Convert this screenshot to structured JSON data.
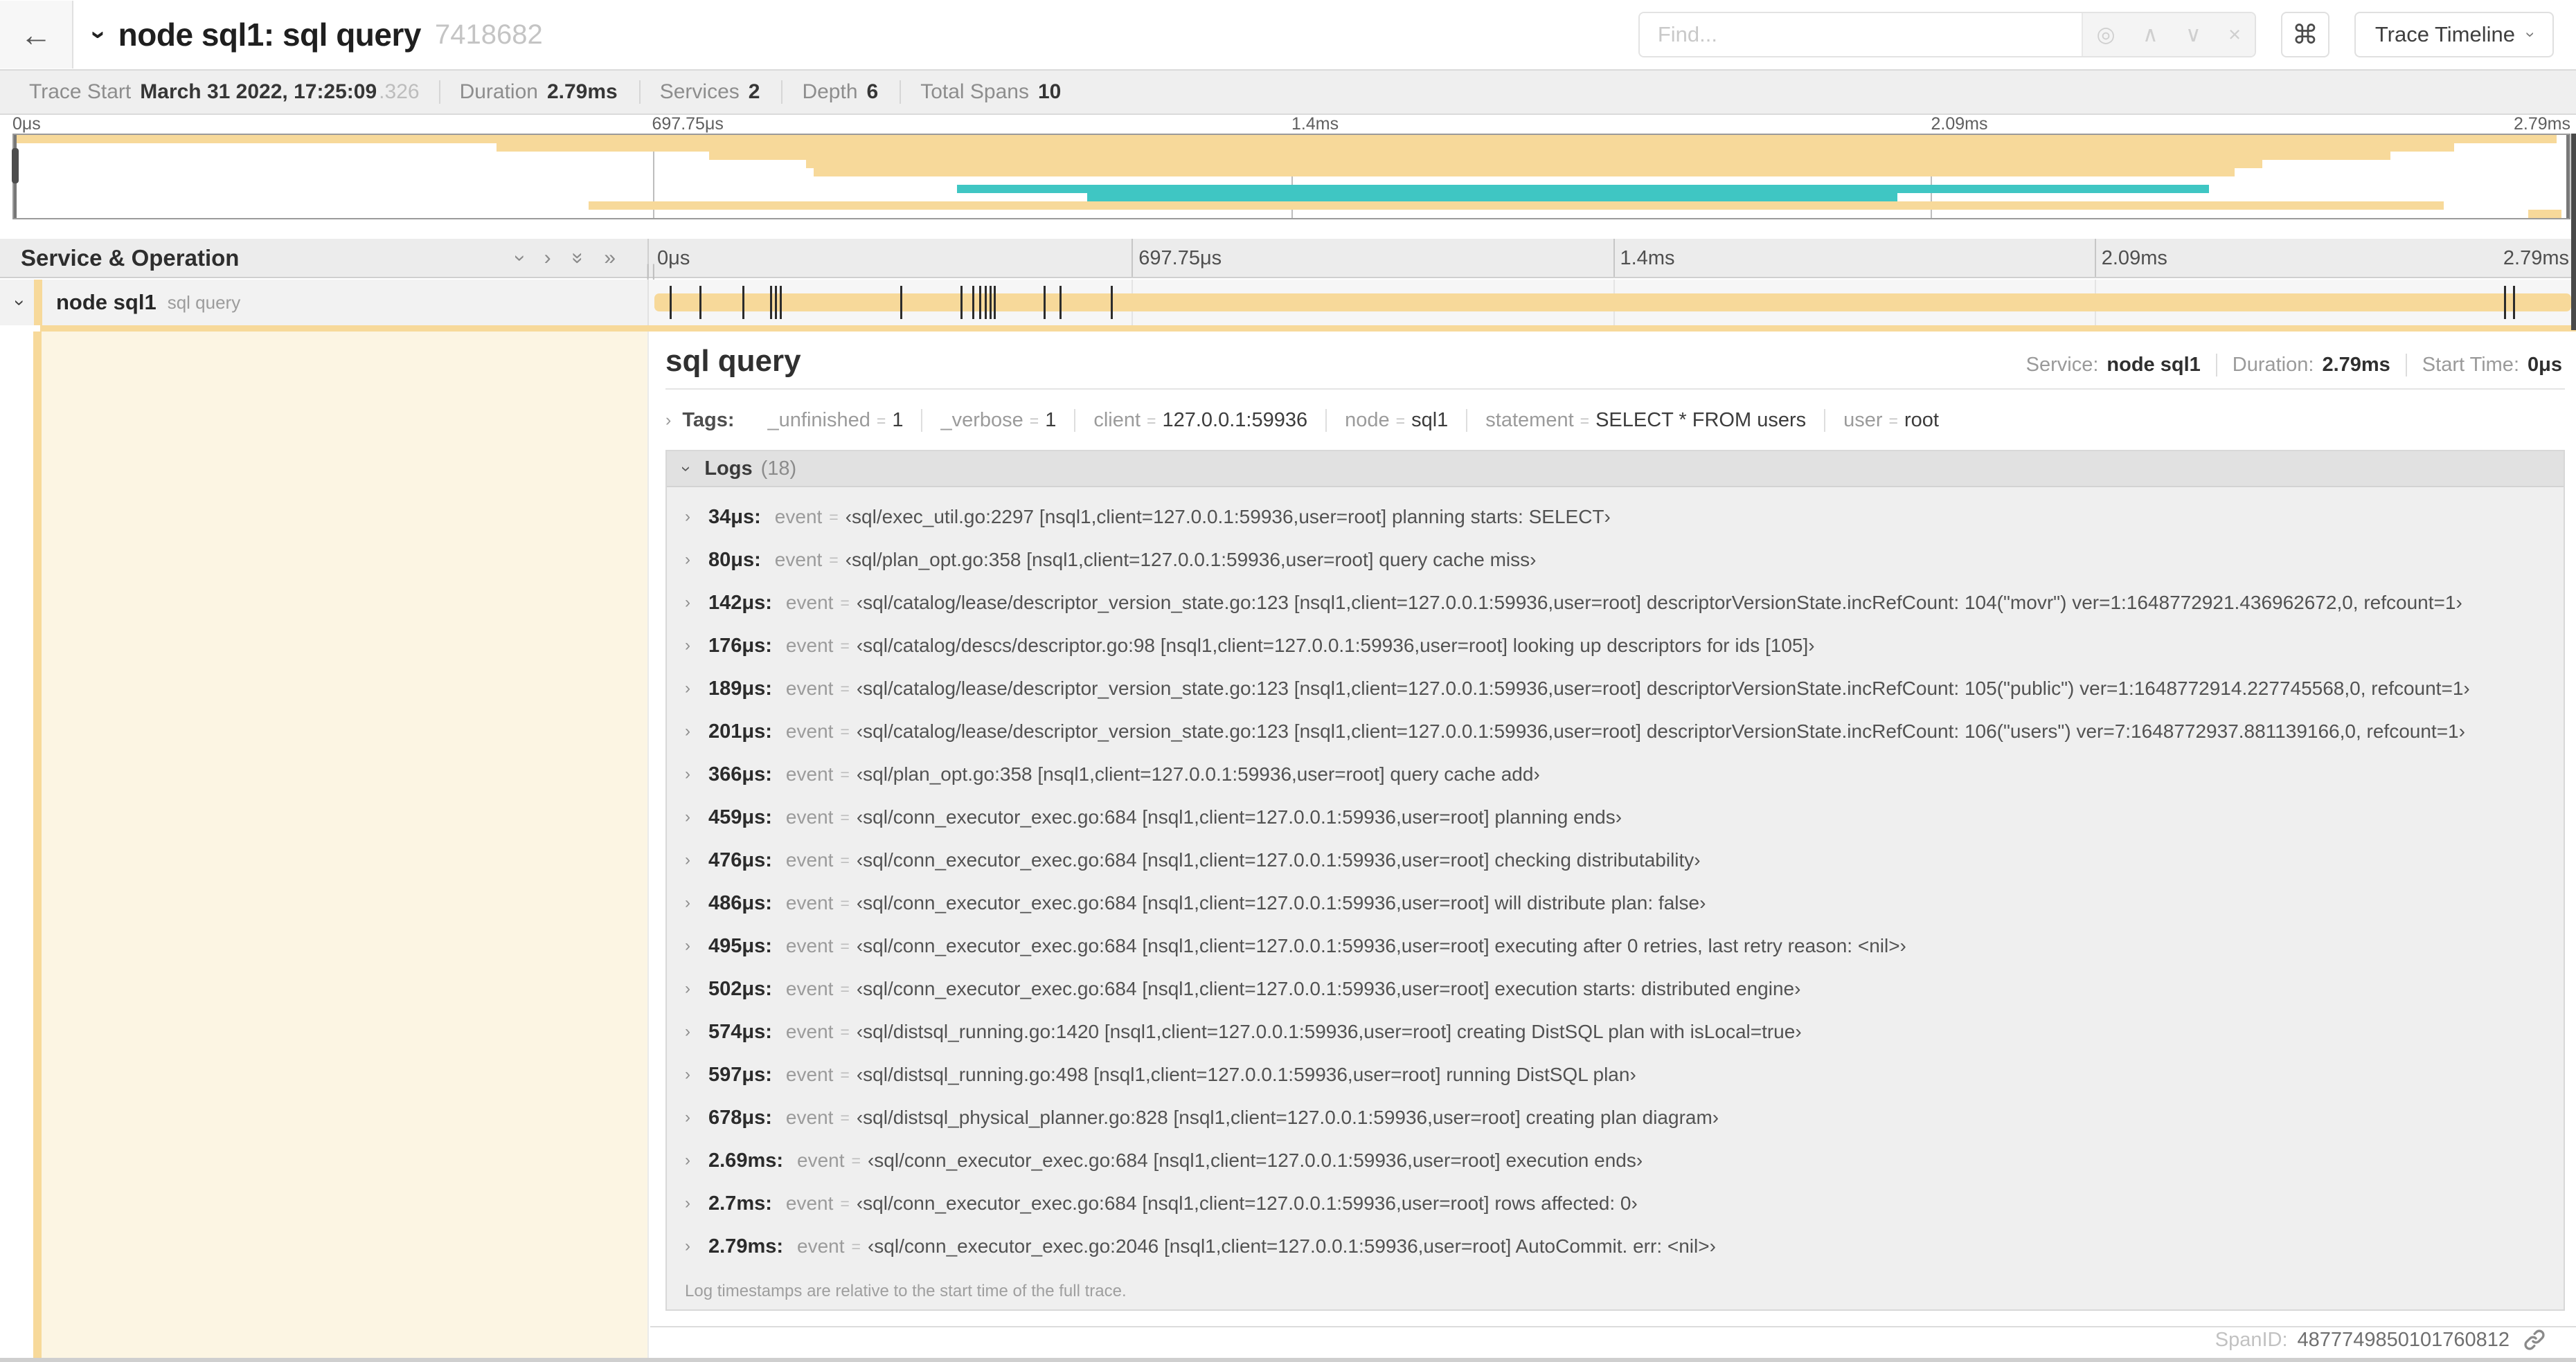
{
  "colors": {
    "span_tan": "#F7D99A",
    "span_teal": "#3FC6C3",
    "detail_cream": "#FCF5E3",
    "tick_dark": "#2C2C2C"
  },
  "header": {
    "back_glyph": "←",
    "collapse_glyph": "›",
    "title": "node sql1: sql query",
    "trace_id": "7418682",
    "find": {
      "placeholder": "Find...",
      "locate_glyph": "◎",
      "prev_glyph": "∧",
      "next_glyph": "∨",
      "clear_glyph": "×"
    },
    "shortcut_glyph": "⌘",
    "view_selector": "Trace Timeline",
    "view_chevron": "›"
  },
  "trace_meta": {
    "items": [
      {
        "label": "Trace Start",
        "value": "March 31 2022, 17:25:09",
        "suffix": ".326"
      },
      {
        "label": "Duration",
        "value": "2.79ms",
        "suffix": ""
      },
      {
        "label": "Services",
        "value": "2",
        "suffix": ""
      },
      {
        "label": "Depth",
        "value": "6",
        "suffix": ""
      },
      {
        "label": "Total Spans",
        "value": "10",
        "suffix": ""
      }
    ]
  },
  "ruler": {
    "ticks": [
      {
        "label": "0μs",
        "pct": 0,
        "tx": "translateX(0)"
      },
      {
        "label": "697.75μs",
        "pct": 25,
        "tx": "translateX(0)"
      },
      {
        "label": "1.4ms",
        "pct": 50,
        "tx": "translateX(0)"
      },
      {
        "label": "2.09ms",
        "pct": 75,
        "tx": "translateX(0)"
      },
      {
        "label": "2.79ms",
        "pct": 100,
        "tx": "translateX(-100%)"
      }
    ],
    "grid": [
      {
        "pct": 25
      },
      {
        "pct": 50
      },
      {
        "pct": 75
      }
    ]
  },
  "minimap": {
    "spans": [
      {
        "top_pct": 0,
        "left_pct": 0,
        "width_pct": 99.5,
        "color": "#F7D99A"
      },
      {
        "top_pct": 10,
        "left_pct": 18.9,
        "width_pct": 76.6,
        "color": "#F7D99A"
      },
      {
        "top_pct": 20,
        "left_pct": 27.2,
        "width_pct": 65.8,
        "color": "#F7D99A"
      },
      {
        "top_pct": 30,
        "left_pct": 31.0,
        "width_pct": 57.0,
        "color": "#F7D99A"
      },
      {
        "top_pct": 40,
        "left_pct": 31.3,
        "width_pct": 55.6,
        "color": "#F7D99A"
      },
      {
        "top_pct": 60,
        "left_pct": 36.9,
        "width_pct": 49.0,
        "color": "#3FC6C3"
      },
      {
        "top_pct": 70,
        "left_pct": 42.0,
        "width_pct": 31.7,
        "color": "#3FC6C3"
      },
      {
        "top_pct": 80,
        "left_pct": 22.5,
        "width_pct": 72.6,
        "color": "#F7D99A"
      },
      {
        "top_pct": 90,
        "left_pct": 98.4,
        "width_pct": 1.3,
        "color": "#F7D99A"
      }
    ]
  },
  "timeline": {
    "column_header": "Service & Operation",
    "icons": {
      "collapse_one": "›",
      "expand_one": "›",
      "collapse_all": "»",
      "expand_all": "»"
    },
    "resizer_grip": "||",
    "row": {
      "chevron": "›",
      "service": "node sql1",
      "operation": "sql query",
      "ticks": [
        {
          "pct": 1.01
        },
        {
          "pct": 2.55
        },
        {
          "pct": 4.78
        },
        {
          "pct": 6.22
        },
        {
          "pct": 6.47
        },
        {
          "pct": 6.72
        },
        {
          "pct": 12.97
        },
        {
          "pct": 16.1
        },
        {
          "pct": 16.71
        },
        {
          "pct": 17.07
        },
        {
          "pct": 17.35
        },
        {
          "pct": 17.61
        },
        {
          "pct": 17.82
        },
        {
          "pct": 20.41
        },
        {
          "pct": 21.24
        },
        {
          "pct": 23.93
        },
        {
          "pct": 96.26
        },
        {
          "pct": 96.73
        }
      ]
    }
  },
  "detail": {
    "title": "sql query",
    "stats": [
      {
        "label": "Service:",
        "value": "node sql1"
      },
      {
        "label": "Duration:",
        "value": "2.79ms"
      },
      {
        "label": "Start Time:",
        "value": "0μs"
      }
    ],
    "tags_chevron": "›",
    "tags_label": "Tags:",
    "eq": "=",
    "tags": [
      {
        "key": "_unfinished",
        "value": "1"
      },
      {
        "key": "_verbose",
        "value": "1"
      },
      {
        "key": "client",
        "value": "127.0.0.1:59936"
      },
      {
        "key": "node",
        "value": "sql1"
      },
      {
        "key": "statement",
        "value": "SELECT * FROM users"
      },
      {
        "key": "user",
        "value": "root"
      }
    ],
    "logs_chevron": "›",
    "logs_label": "Logs",
    "logs_count": "(18)",
    "log_chevron": "›",
    "log_key": "event",
    "logs": [
      {
        "ts": "34μs:",
        "msg": "‹sql/exec_util.go:2297 [nsql1,client=127.0.0.1:59936,user=root] planning starts: SELECT›"
      },
      {
        "ts": "80μs:",
        "msg": "‹sql/plan_opt.go:358 [nsql1,client=127.0.0.1:59936,user=root] query cache miss›"
      },
      {
        "ts": "142μs:",
        "msg": "‹sql/catalog/lease/descriptor_version_state.go:123 [nsql1,client=127.0.0.1:59936,user=root] descriptorVersionState.incRefCount: 104(\"movr\") ver=1:1648772921.436962672,0, refcount=1›"
      },
      {
        "ts": "176μs:",
        "msg": "‹sql/catalog/descs/descriptor.go:98 [nsql1,client=127.0.0.1:59936,user=root] looking up descriptors for ids [105]›"
      },
      {
        "ts": "189μs:",
        "msg": "‹sql/catalog/lease/descriptor_version_state.go:123 [nsql1,client=127.0.0.1:59936,user=root] descriptorVersionState.incRefCount: 105(\"public\") ver=1:1648772914.227745568,0, refcount=1›"
      },
      {
        "ts": "201μs:",
        "msg": "‹sql/catalog/lease/descriptor_version_state.go:123 [nsql1,client=127.0.0.1:59936,user=root] descriptorVersionState.incRefCount: 106(\"users\") ver=7:1648772937.881139166,0, refcount=1›"
      },
      {
        "ts": "366μs:",
        "msg": "‹sql/plan_opt.go:358 [nsql1,client=127.0.0.1:59936,user=root] query cache add›"
      },
      {
        "ts": "459μs:",
        "msg": "‹sql/conn_executor_exec.go:684 [nsql1,client=127.0.0.1:59936,user=root] planning ends›"
      },
      {
        "ts": "476μs:",
        "msg": "‹sql/conn_executor_exec.go:684 [nsql1,client=127.0.0.1:59936,user=root] checking distributability›"
      },
      {
        "ts": "486μs:",
        "msg": "‹sql/conn_executor_exec.go:684 [nsql1,client=127.0.0.1:59936,user=root] will distribute plan: false›"
      },
      {
        "ts": "495μs:",
        "msg": "‹sql/conn_executor_exec.go:684 [nsql1,client=127.0.0.1:59936,user=root] executing after 0 retries, last retry reason: <nil>›"
      },
      {
        "ts": "502μs:",
        "msg": "‹sql/conn_executor_exec.go:684 [nsql1,client=127.0.0.1:59936,user=root] execution starts: distributed engine›"
      },
      {
        "ts": "574μs:",
        "msg": "‹sql/distsql_running.go:1420 [nsql1,client=127.0.0.1:59936,user=root] creating DistSQL plan with isLocal=true›"
      },
      {
        "ts": "597μs:",
        "msg": "‹sql/distsql_running.go:498 [nsql1,client=127.0.0.1:59936,user=root] running DistSQL plan›"
      },
      {
        "ts": "678μs:",
        "msg": "‹sql/distsql_physical_planner.go:828 [nsql1,client=127.0.0.1:59936,user=root] creating plan diagram›"
      },
      {
        "ts": "2.69ms:",
        "msg": "‹sql/conn_executor_exec.go:684 [nsql1,client=127.0.0.1:59936,user=root] execution ends›"
      },
      {
        "ts": "2.7ms:",
        "msg": "‹sql/conn_executor_exec.go:684 [nsql1,client=127.0.0.1:59936,user=root] rows affected: 0›"
      },
      {
        "ts": "2.79ms:",
        "msg": "‹sql/conn_executor_exec.go:2046 [nsql1,client=127.0.0.1:59936,user=root] AutoCommit. err: <nil>›"
      }
    ],
    "logs_note": "Log timestamps are relative to the start time of the full trace.",
    "spanid_label": "SpanID:",
    "spanid": "4877749850101760812"
  }
}
